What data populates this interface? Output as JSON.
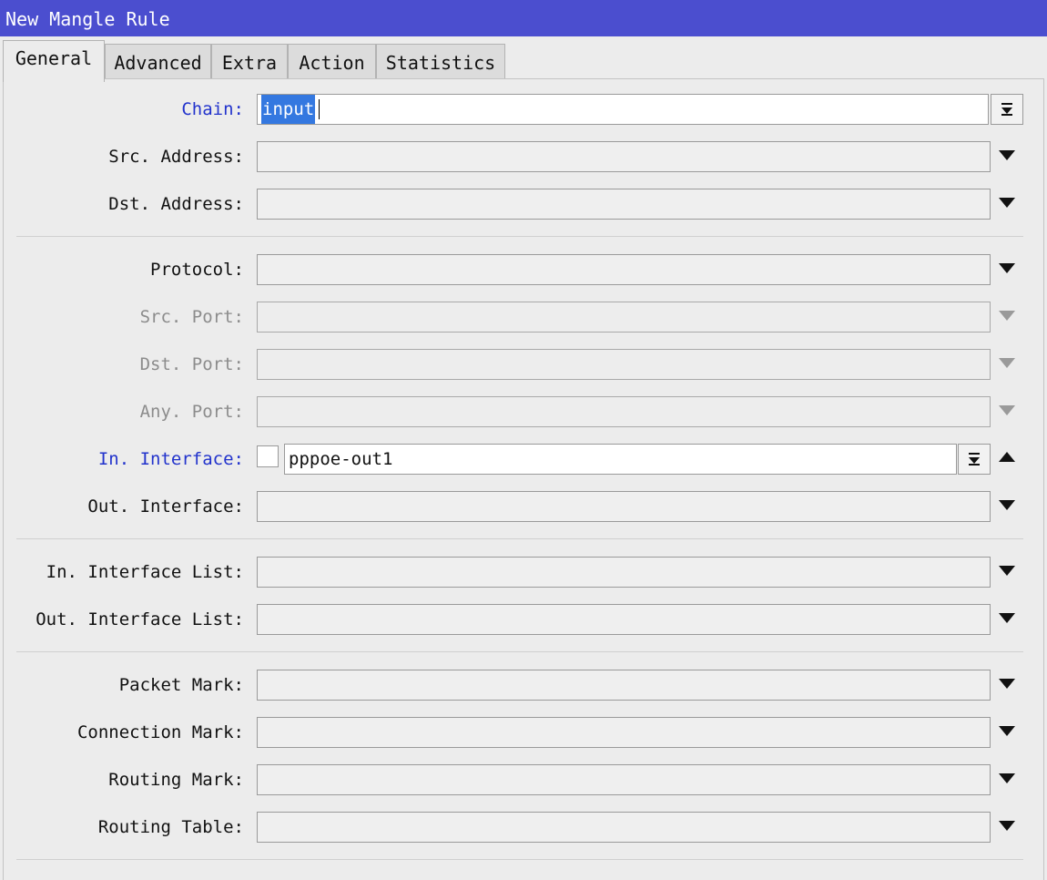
{
  "window": {
    "title": "New Mangle Rule"
  },
  "tabs": [
    "General",
    "Advanced",
    "Extra",
    "Action",
    "Statistics"
  ],
  "fields": {
    "chain": {
      "label": "Chain:",
      "value": "input"
    },
    "src_address": {
      "label": "Src. Address:",
      "value": ""
    },
    "dst_address": {
      "label": "Dst. Address:",
      "value": ""
    },
    "protocol": {
      "label": "Protocol:",
      "value": ""
    },
    "src_port": {
      "label": "Src. Port:",
      "value": ""
    },
    "dst_port": {
      "label": "Dst. Port:",
      "value": ""
    },
    "any_port": {
      "label": "Any. Port:",
      "value": ""
    },
    "in_interface": {
      "label": "In. Interface:",
      "value": "pppoe-out1",
      "negate": false
    },
    "out_interface": {
      "label": "Out. Interface:",
      "value": ""
    },
    "in_interface_list": {
      "label": "In. Interface List:",
      "value": ""
    },
    "out_interface_list": {
      "label": "Out. Interface List:",
      "value": ""
    },
    "packet_mark": {
      "label": "Packet Mark:",
      "value": ""
    },
    "connection_mark": {
      "label": "Connection Mark:",
      "value": ""
    },
    "routing_mark": {
      "label": "Routing Mark:",
      "value": ""
    },
    "routing_table": {
      "label": "Routing Table:",
      "value": ""
    }
  },
  "icons": {
    "dropdown": "triangle-down-icon",
    "collapse": "triangle-up-icon",
    "select": "select-list-icon"
  },
  "colors": {
    "titlebar": "#4b4ecf",
    "label_active": "#2233cc",
    "label_disabled": "#8c8c8c",
    "selection": "#3478e0"
  }
}
